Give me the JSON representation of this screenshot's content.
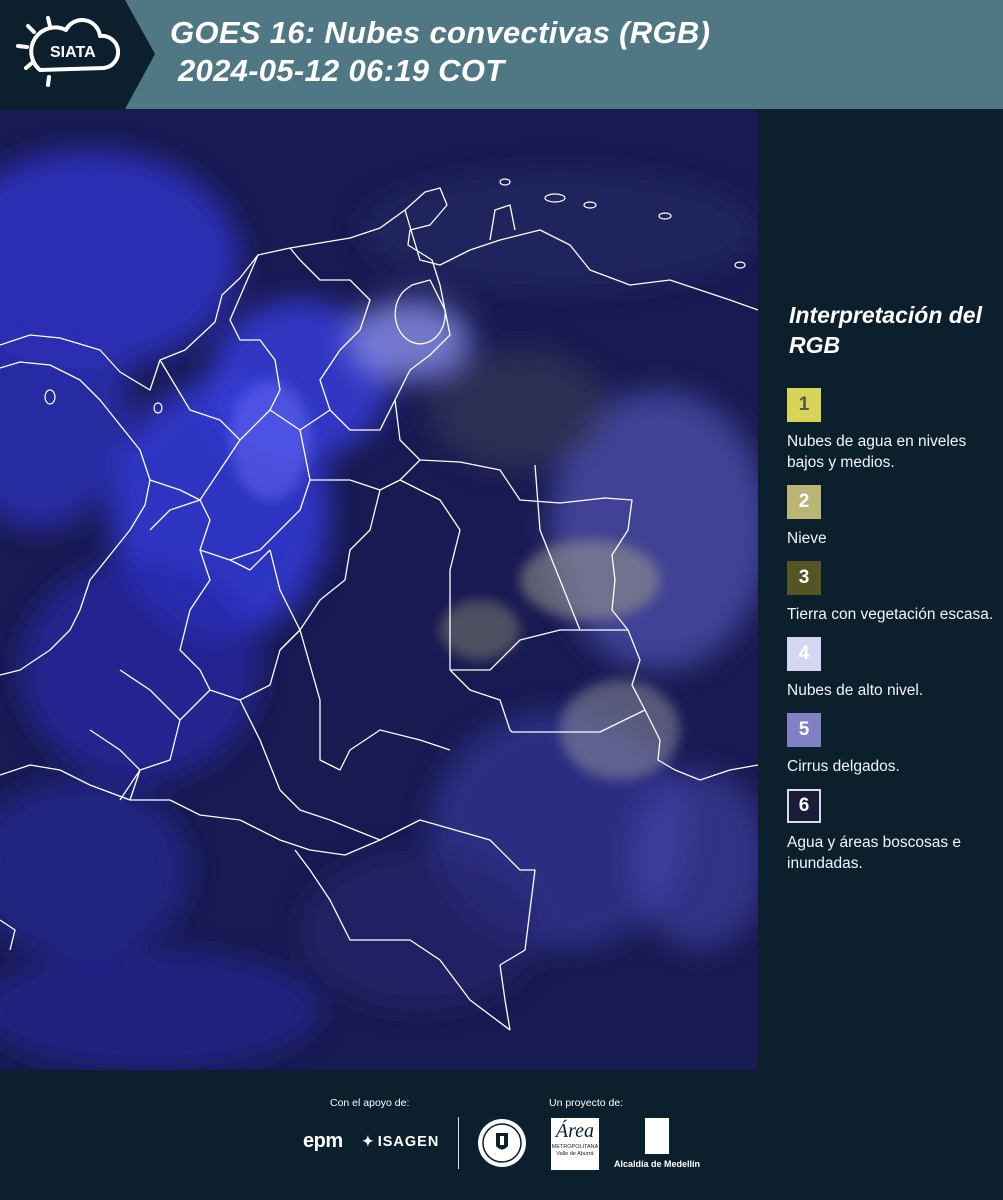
{
  "header": {
    "logo_text": "SIATA",
    "title_line1": "GOES 16: Nubes convectivas (RGB)",
    "title_line2": "2024-05-12 06:19 COT"
  },
  "legend": {
    "title": "Interpretación del RGB",
    "items": [
      {
        "number": "1",
        "label": "Nubes de agua en niveles bajos y medios.",
        "color": "#d8d456",
        "number_color": "#555555"
      },
      {
        "number": "2",
        "label": "Nieve",
        "color": "#b8b577",
        "number_color": "#ffffff"
      },
      {
        "number": "3",
        "label": "Tierra con vegetación escasa.",
        "color": "#545522",
        "number_color": "#ffffff"
      },
      {
        "number": "4",
        "label": "Nubes de alto nivel.",
        "color": "#d6d5f4",
        "number_color": "#ffffff"
      },
      {
        "number": "5",
        "label": "Cirrus delgados.",
        "color": "#8080c4",
        "number_color": "#ffffff"
      },
      {
        "number": "6",
        "label": "Agua y áreas boscosas e inundadas.",
        "color": "#1b1b38",
        "number_color": "#ffffff"
      }
    ]
  },
  "footer": {
    "support_label": "Con el apoyo de:",
    "project_label": "Un proyecto de:",
    "sponsors": [
      "epm",
      "ISAGEN"
    ],
    "area_logo_text": "Área",
    "area_logo_subtext": "METROPOLITANA Valle de Aburrá",
    "medellin_label": "Alcaldía de Medellín"
  }
}
